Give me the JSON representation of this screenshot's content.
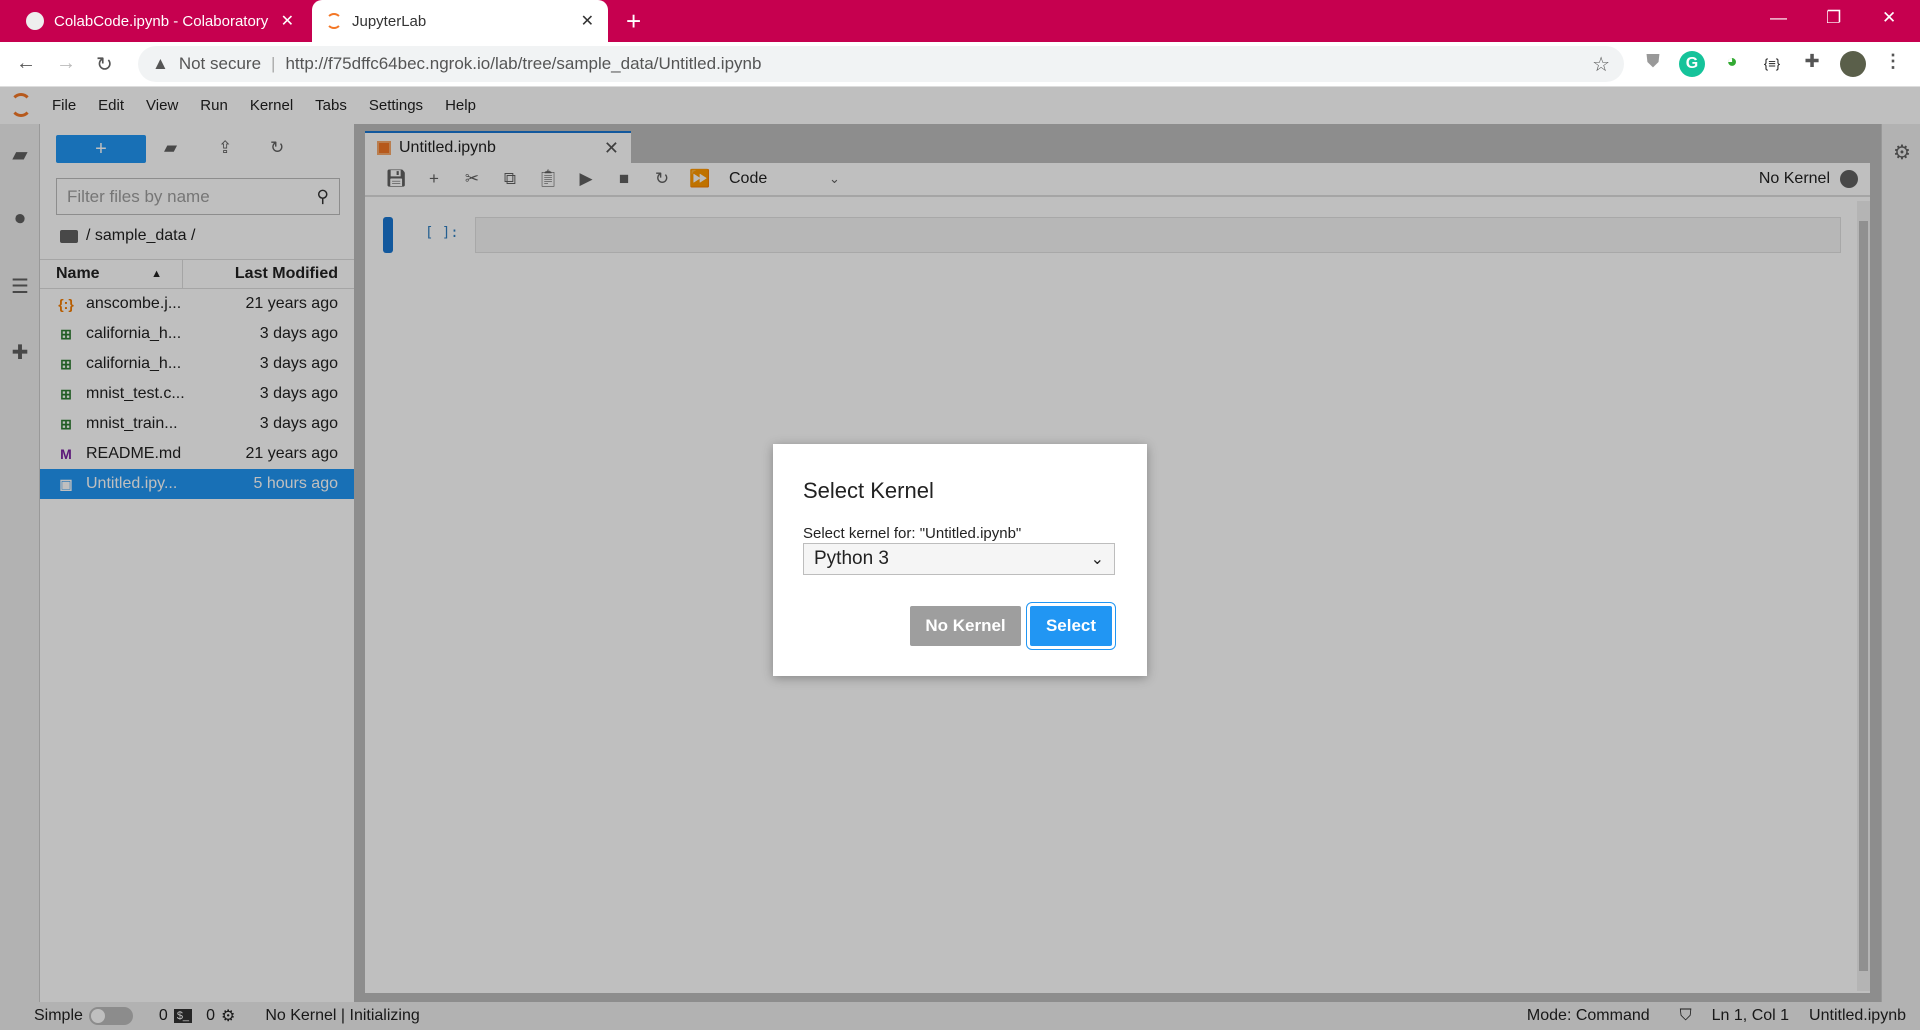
{
  "browser": {
    "tabs": [
      {
        "label": "ColabCode.ipynb - Colaboratory",
        "icon": "colab-icon"
      },
      {
        "label": "JupyterLab",
        "icon": "jupyter-icon",
        "active": true
      }
    ],
    "security": "Not secure",
    "url": "http://f75dffc64bec.ngrok.io/lab/tree/sample_data/Untitled.ipynb"
  },
  "menu": [
    "File",
    "Edit",
    "View",
    "Run",
    "Kernel",
    "Tabs",
    "Settings",
    "Help"
  ],
  "filebrowser": {
    "filter_placeholder": "Filter files by name",
    "breadcrumb": "/ sample_data /",
    "col_name": "Name",
    "col_modified": "Last Modified",
    "files": [
      {
        "name": "anscombe.j...",
        "modified": "21 years ago",
        "type": "json"
      },
      {
        "name": "california_h...",
        "modified": "3 days ago",
        "type": "csv"
      },
      {
        "name": "california_h...",
        "modified": "3 days ago",
        "type": "csv"
      },
      {
        "name": "mnist_test.c...",
        "modified": "3 days ago",
        "type": "csv"
      },
      {
        "name": "mnist_train...",
        "modified": "3 days ago",
        "type": "csv"
      },
      {
        "name": "README.md",
        "modified": "21 years ago",
        "type": "markdown"
      },
      {
        "name": "Untitled.ipy...",
        "modified": "5 hours ago",
        "type": "notebook",
        "selected": true
      }
    ]
  },
  "notebook": {
    "tab": "Untitled.ipynb",
    "cell_type": "Code",
    "kernel": "No Kernel",
    "prompt": "[ ]:"
  },
  "status": {
    "mode_label": "Simple",
    "terminals": "0",
    "kernels": "0",
    "kernel_status": "No Kernel | Initializing",
    "mode": "Mode: Command",
    "position": "Ln 1, Col 1",
    "file": "Untitled.ipynb"
  },
  "dialog": {
    "title": "Select Kernel",
    "label": "Select kernel for: \"Untitled.ipynb\"",
    "selected": "Python 3",
    "no_kernel": "No Kernel",
    "select": "Select"
  },
  "colors": {
    "chrome": "#c6004f",
    "accent": "#2196f3",
    "jupyter": "#f37726"
  }
}
